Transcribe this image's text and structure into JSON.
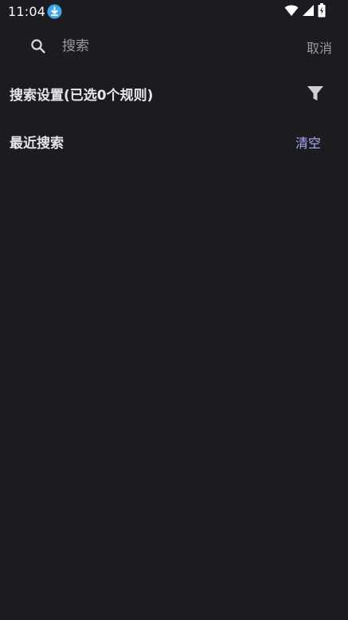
{
  "status_bar": {
    "time": "11:04",
    "icons": [
      "download-icon",
      "wifi-icon",
      "signal-icon",
      "battery-charging-icon"
    ]
  },
  "search": {
    "placeholder": "搜索",
    "value": "",
    "cancel_label": "取消"
  },
  "search_settings": {
    "title": "搜索设置(已选0个规则)",
    "icon": "filter-icon"
  },
  "recent": {
    "title": "最近搜索",
    "clear_label": "清空",
    "items": []
  },
  "colors": {
    "background": "#1c1b20",
    "accent": "#aab0ff",
    "muted": "#9a9aa0",
    "download_badge": "#3ba7e8"
  }
}
